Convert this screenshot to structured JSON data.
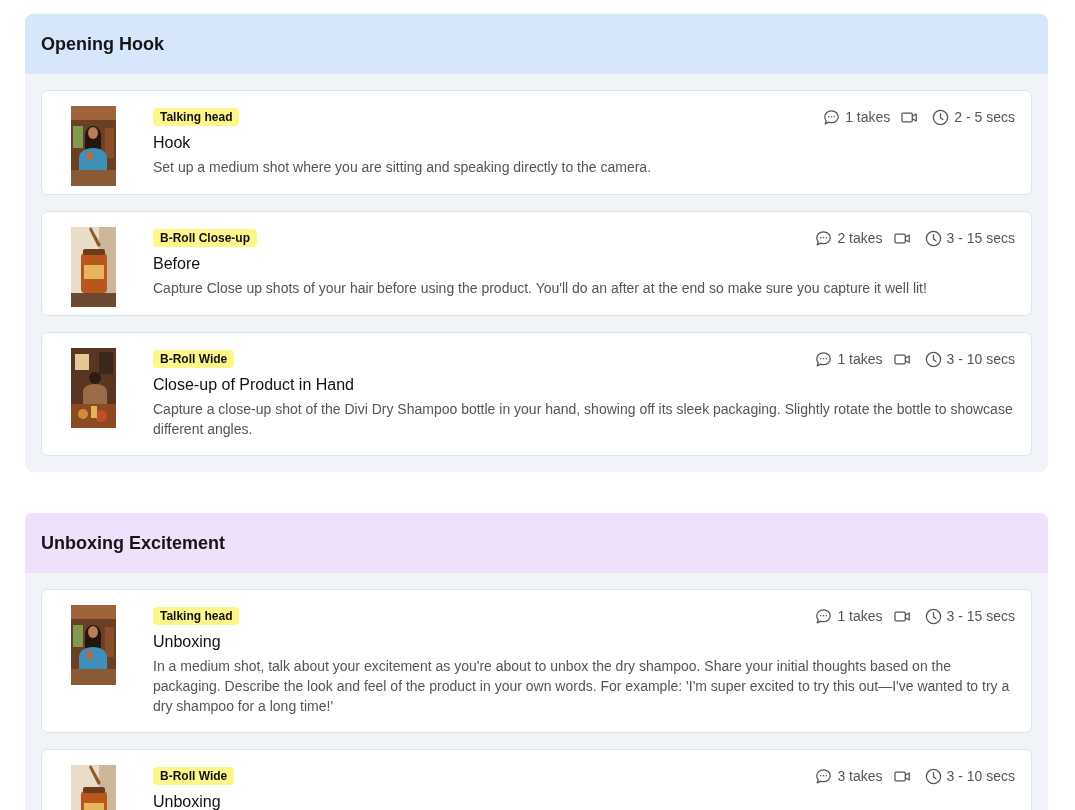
{
  "sections": [
    {
      "title": "Opening Hook",
      "color": "#d6e6fb",
      "shots": [
        {
          "tag": "Talking head",
          "title": "Hook",
          "description": "Set up a medium shot where you are sitting and speaking directly to the camera.",
          "takes": "1 takes",
          "duration": "2 - 5 secs"
        },
        {
          "tag": "B-Roll Close-up",
          "title": "Before",
          "description": "Capture Close up shots of your hair before using the product. You'll do an after at the end so make sure you capture it well lit!",
          "takes": "2 takes",
          "duration": "3 - 15 secs"
        },
        {
          "tag": "B-Roll Wide",
          "title": "Close-up of Product in Hand",
          "description": "Capture a close-up shot of the Divi Dry Shampoo bottle in your hand, showing off its sleek packaging. Slightly rotate the bottle to showcase different angles.",
          "takes": "1 takes",
          "duration": "3 - 10 secs"
        }
      ]
    },
    {
      "title": "Unboxing Excitement",
      "color": "#efe0fb",
      "shots": [
        {
          "tag": "Talking head",
          "title": "Unboxing",
          "description": "In a medium shot, talk about your excitement as you're about to unbox the dry shampoo. Share your initial thoughts based on the packaging. Describe the look and feel of the product in your own words. For example: 'I'm super excited to try this out—I've wanted to try a dry shampoo for a long time!'",
          "takes": "1 takes",
          "duration": "3 - 15 secs"
        },
        {
          "tag": "B-Roll Wide",
          "title": "Unboxing",
          "takes": "3 takes",
          "duration": "3 - 10 secs"
        }
      ]
    }
  ]
}
